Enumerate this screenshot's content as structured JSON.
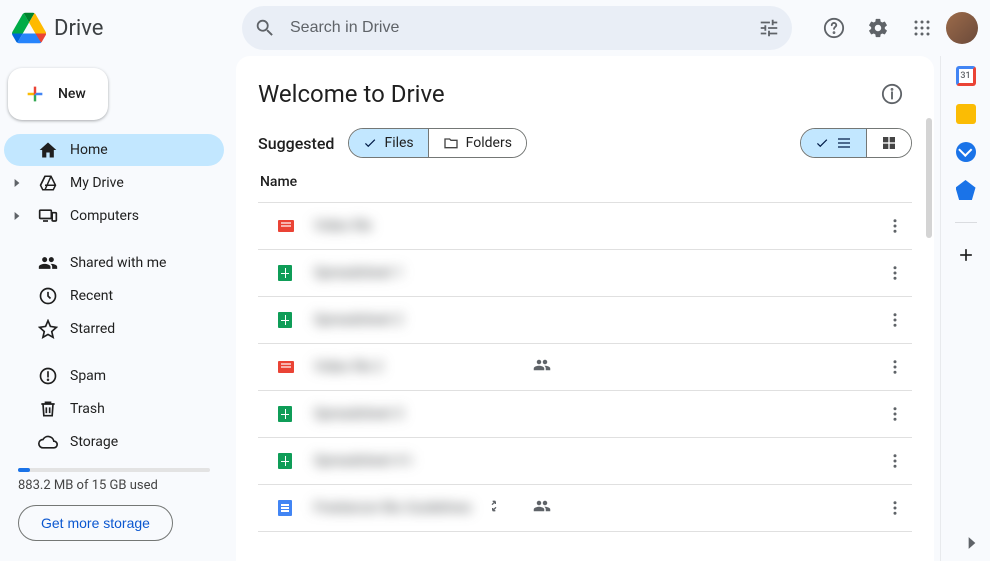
{
  "app": {
    "name": "Drive"
  },
  "search": {
    "placeholder": "Search in Drive"
  },
  "new_button": {
    "label": "New"
  },
  "sidebar": {
    "items": [
      {
        "label": "Home",
        "icon": "home",
        "selected": true,
        "expandable": false
      },
      {
        "label": "My Drive",
        "icon": "drive",
        "selected": false,
        "expandable": true
      },
      {
        "label": "Computers",
        "icon": "computers",
        "selected": false,
        "expandable": true
      }
    ],
    "items2": [
      {
        "label": "Shared with me",
        "icon": "shared"
      },
      {
        "label": "Recent",
        "icon": "recent"
      },
      {
        "label": "Starred",
        "icon": "star"
      }
    ],
    "items3": [
      {
        "label": "Spam",
        "icon": "spam"
      },
      {
        "label": "Trash",
        "icon": "trash"
      },
      {
        "label": "Storage",
        "icon": "cloud"
      }
    ]
  },
  "storage": {
    "text": "883.2 MB of 15 GB used",
    "cta": "Get more storage",
    "percent": 6
  },
  "panel": {
    "title": "Welcome to Drive",
    "suggested": "Suggested",
    "files_tab": "Files",
    "folders_tab": "Folders",
    "columns": {
      "name": "Name"
    }
  },
  "files": [
    {
      "type": "video",
      "name": "Video file",
      "shared": false
    },
    {
      "type": "sheet",
      "name": "Spreadsheet 1",
      "shared": false
    },
    {
      "type": "sheet",
      "name": "Spreadsheet 2",
      "shared": false
    },
    {
      "type": "video",
      "name": "Video file 2",
      "shared": true
    },
    {
      "type": "sheet",
      "name": "Spreadsheet 3",
      "shared": false
    },
    {
      "type": "sheet",
      "name": "Spreadsheet 4 l-",
      "shared": false
    },
    {
      "type": "doc",
      "name": "Freelancer Bio Guidelines",
      "shared": true,
      "shortcut": true
    }
  ]
}
